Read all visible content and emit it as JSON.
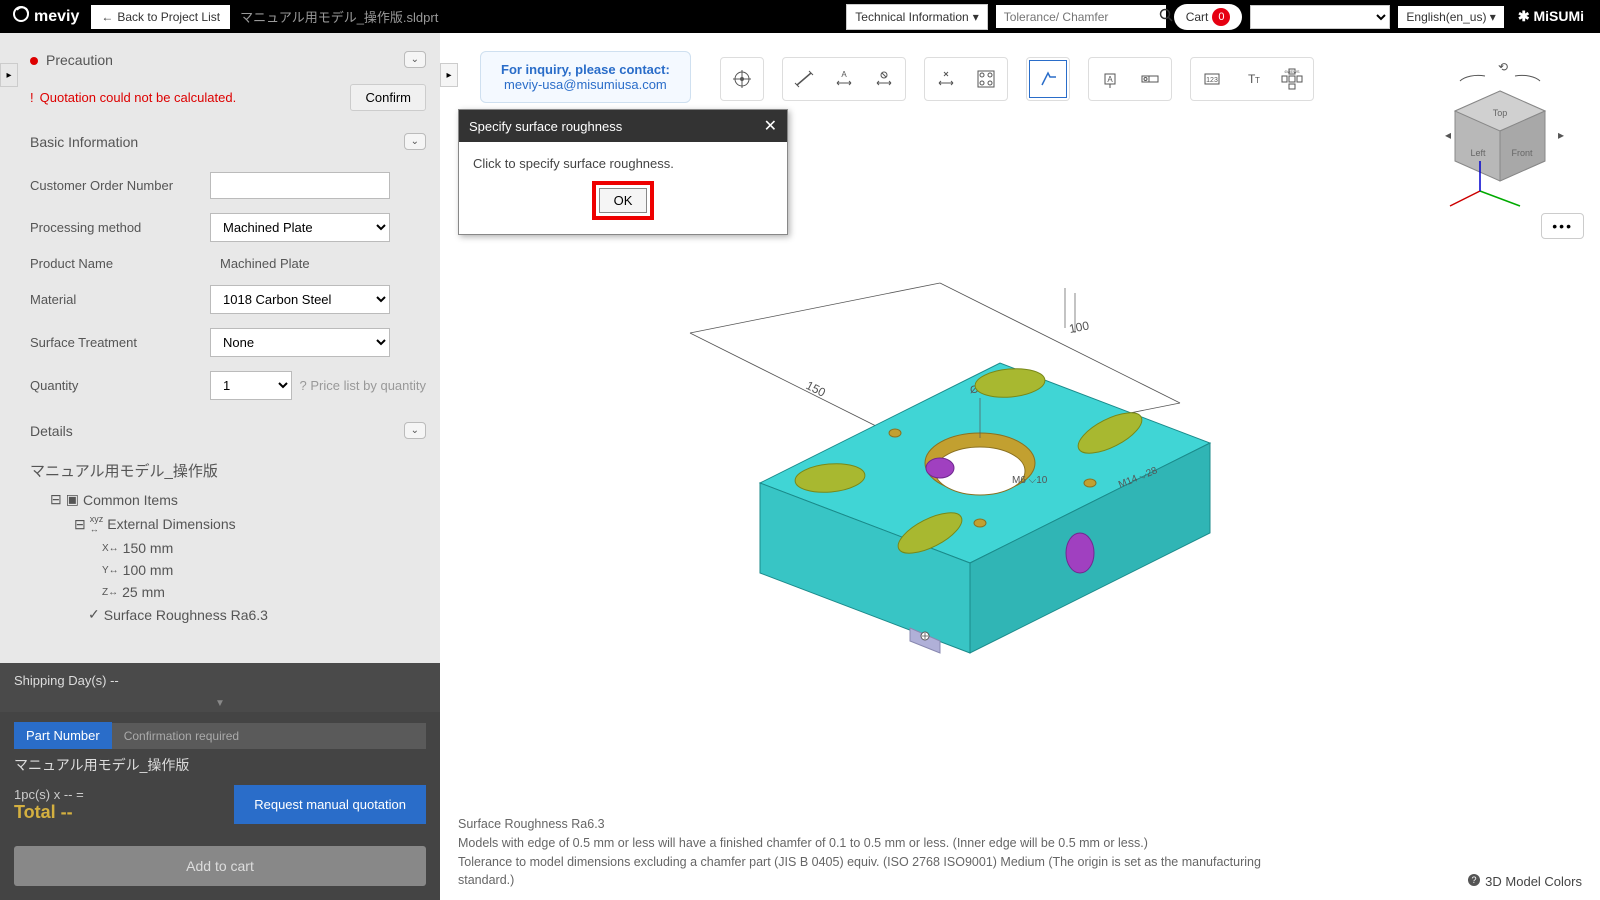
{
  "topbar": {
    "logo": "meviy",
    "back": "Back to Project List",
    "filename": "マニュアル用モデル_操作版.sldprt",
    "tech_info": "Technical Information",
    "search_placeholder": "Tolerance/ Chamfer",
    "cart": "Cart",
    "cart_count": "0",
    "language": "English(en_us)",
    "misumi": "MiSUMi"
  },
  "sidebar": {
    "precaution": "Precaution",
    "alert": "Quotation could not be calculated.",
    "confirm": "Confirm",
    "basic_info": "Basic Information",
    "fields": {
      "customer_order": "Customer Order Number",
      "processing_method": "Processing method",
      "processing_value": "Machined Plate",
      "product_name": "Product Name",
      "product_value": "Machined Plate",
      "material": "Material",
      "material_value": "1018 Carbon Steel",
      "surface": "Surface Treatment",
      "surface_value": "None",
      "quantity": "Quantity",
      "quantity_value": "1",
      "price_list": "Price list by quantity"
    },
    "details": "Details",
    "tree": {
      "root": "マニュアル用モデル_操作版",
      "common": "Common Items",
      "external": "External Dimensions",
      "x": "150 mm",
      "y": "100 mm",
      "z": "25 mm",
      "roughness": "Surface Roughness Ra6.3"
    }
  },
  "bottom": {
    "shipping": "Shipping Day(s) --",
    "part_number": "Part Number",
    "conf_required": "Confirmation required",
    "model_name": "マニュアル用モデル_操作版",
    "pcs": "1pc(s)  x -- =",
    "total": "Total --",
    "request": "Request manual quotation",
    "add_cart": "Add to cart"
  },
  "viewer": {
    "inquiry_label": "For inquiry, please contact:",
    "inquiry_email": "meviy-usa@misumiusa.com",
    "dialog_title": "Specify surface roughness",
    "dialog_body": "Click to specify surface roughness.",
    "dialog_ok": "OK",
    "footer1": "Surface Roughness Ra6.3",
    "footer2": "Models with edge of 0.5 mm or less will have a finished chamfer of 0.1 to 0.5 mm or less. (Inner edge will be 0.5 mm or less.)",
    "footer3": "Tolerance to model dimensions excluding a chamfer part (JIS B 0405) equiv. (ISO 2768 ISO9001) Medium (The origin is set as the manufacturing standard.)",
    "colors": "3D Model Colors",
    "dim_150": "150",
    "dim_100": "100",
    "dim_040": "Ø40",
    "dim_m14": "M14 ⌵28",
    "dim_m6": "M6 ⌵10"
  }
}
